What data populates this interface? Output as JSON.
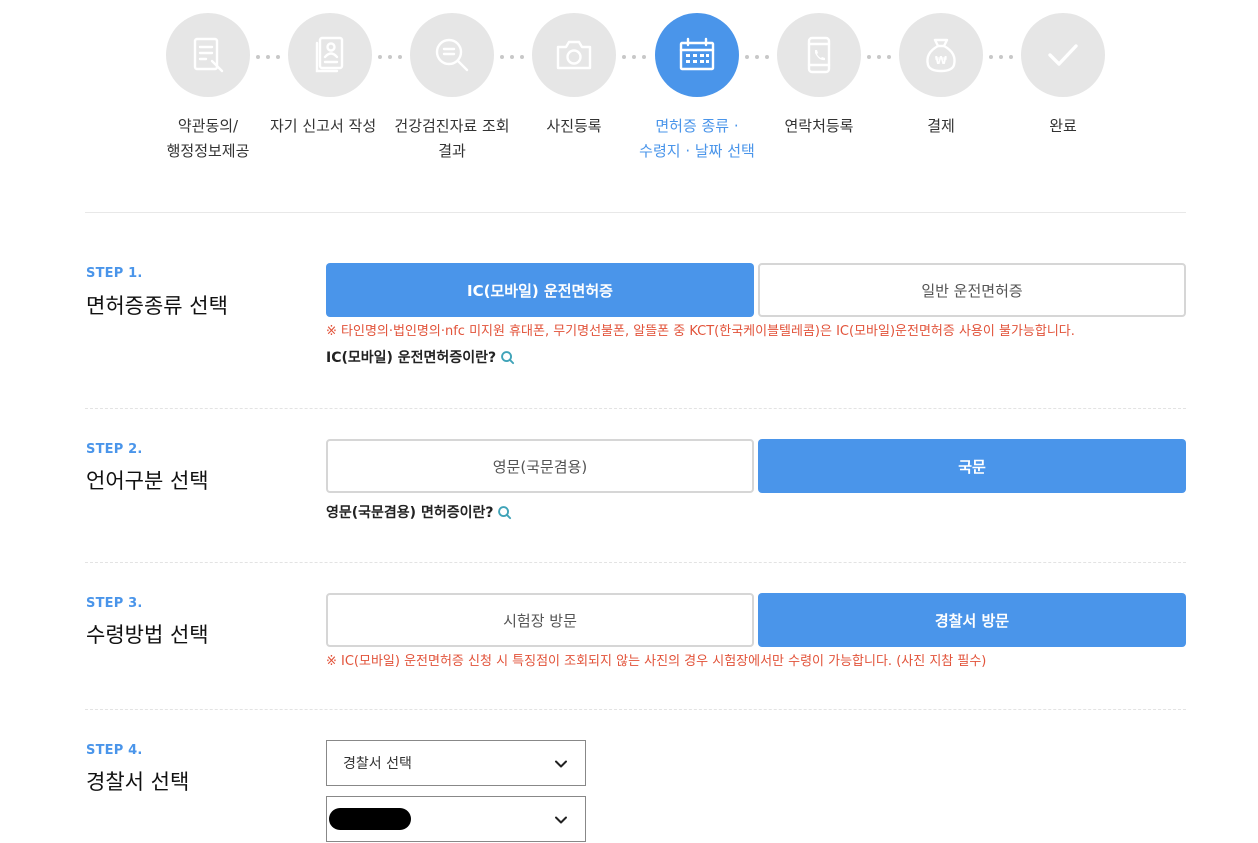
{
  "progress": {
    "steps": [
      {
        "icon": "document-pen-icon",
        "label_lines": [
          "약관동의/",
          "행정정보제공"
        ],
        "active": false
      },
      {
        "icon": "id-card-icon",
        "label_lines": [
          "자기 신고서 작성",
          ""
        ],
        "active": false
      },
      {
        "icon": "search-document-icon",
        "label_lines": [
          "건강검진자료 조회",
          "결과"
        ],
        "active": false
      },
      {
        "icon": "camera-icon",
        "label_lines": [
          "사진등록",
          ""
        ],
        "active": false
      },
      {
        "icon": "calendar-icon",
        "label_lines": [
          "면허증 종류 ·",
          "수령지 · 날짜 선택"
        ],
        "active": true
      },
      {
        "icon": "phone-icon",
        "label_lines": [
          "연락처등록",
          ""
        ],
        "active": false
      },
      {
        "icon": "money-bag-icon",
        "label_lines": [
          "결제",
          ""
        ],
        "active": false
      },
      {
        "icon": "check-icon",
        "label_lines": [
          "완료",
          ""
        ],
        "active": false
      }
    ],
    "active_color": "#4a95ea",
    "inactive_color": "#e6e6e6"
  },
  "step1": {
    "number": "STEP 1.",
    "title": "면허증종류 선택",
    "options": [
      {
        "label": "IC(모바일) 운전면허증",
        "selected": true
      },
      {
        "label": "일반 운전면허증",
        "selected": false
      }
    ],
    "note": "※ 타인명의·법인명의·nfc 미지원 휴대폰, 무기명선불폰, 알뜰폰 중 KCT(한국케이블텔레콤)은 IC(모바일)운전면허증 사용이 불가능합니다.",
    "info_link": "IC(모바일) 운전면허증이란?"
  },
  "step2": {
    "number": "STEP 2.",
    "title": "언어구분 선택",
    "options": [
      {
        "label": "영문(국문겸용)",
        "selected": false
      },
      {
        "label": "국문",
        "selected": true
      }
    ],
    "info_link": "영문(국문겸용) 면허증이란?"
  },
  "step3": {
    "number": "STEP 3.",
    "title": "수령방법 선택",
    "options": [
      {
        "label": "시험장 방문",
        "selected": false
      },
      {
        "label": "경찰서 방문",
        "selected": true
      }
    ],
    "note": "※ IC(모바일) 운전면허증 신청 시 특징점이 조회되지 않는 사진의 경우 시험장에서만 수령이 가능합니다. (사진 지참 필수)"
  },
  "step4": {
    "number": "STEP 4.",
    "title": "경찰서 선택",
    "select1_value": "경찰서 선택"
  },
  "colors": {
    "accent": "#4a95ea",
    "warning": "#e2533a"
  }
}
